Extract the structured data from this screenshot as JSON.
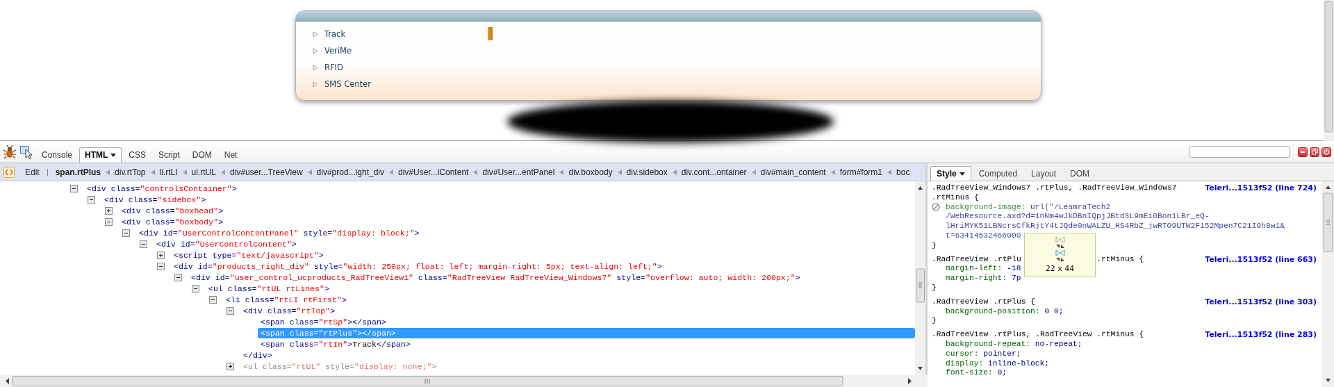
{
  "web_page": {
    "menu_panel": {
      "inspected_highlight": true,
      "items": [
        {
          "label": "Track",
          "expanded": false
        },
        {
          "label": "VeriMe",
          "expanded": false
        },
        {
          "label": "RFID",
          "expanded": false
        },
        {
          "label": "SMS Center",
          "expanded": false
        }
      ]
    }
  },
  "devtools": {
    "tabs": [
      {
        "label": "Console",
        "selected": false,
        "dropdown": false
      },
      {
        "label": "HTML",
        "selected": true,
        "dropdown": true
      },
      {
        "label": "CSS",
        "selected": false,
        "dropdown": false
      },
      {
        "label": "Script",
        "selected": false,
        "dropdown": false
      },
      {
        "label": "DOM",
        "selected": false,
        "dropdown": false
      },
      {
        "label": "Net",
        "selected": false,
        "dropdown": false
      }
    ],
    "breadcrumbs": {
      "edit_label": "Edit",
      "items": [
        {
          "label": "span.rtPlus",
          "selected": true
        },
        {
          "label": "div.rtTop",
          "selected": false
        },
        {
          "label": "li.rtLI",
          "selected": false
        },
        {
          "label": "ul.rtUL",
          "selected": false
        },
        {
          "label": "div#user...TreeView",
          "selected": false
        },
        {
          "label": "div#prod...ight_div",
          "selected": false
        },
        {
          "label": "div#User...lContent",
          "selected": false
        },
        {
          "label": "div#User...entPanel",
          "selected": false
        },
        {
          "label": "div.boxbody",
          "selected": false
        },
        {
          "label": "div.sidebox",
          "selected": false
        },
        {
          "label": "div.cont...ontainer",
          "selected": false
        },
        {
          "label": "div#main_content",
          "selected": false
        },
        {
          "label": "form#form1",
          "selected": false
        },
        {
          "label": "boc",
          "selected": false
        }
      ]
    },
    "html_tree": [
      {
        "selected": false,
        "hidden": false,
        "expanded": true,
        "parts": [
          {
            "kind": "tag",
            "text": "<div"
          },
          {
            "kind": "attr",
            "text": " class="
          },
          {
            "kind": "value",
            "text": "\"controlsContainer\""
          },
          {
            "kind": "tag",
            "text": ">"
          }
        ],
        "children": [
          {
            "selected": false,
            "hidden": false,
            "expanded": true,
            "parts": [
              {
                "kind": "tag",
                "text": "<div"
              },
              {
                "kind": "attr",
                "text": " class="
              },
              {
                "kind": "value",
                "text": "\"sidebox\""
              },
              {
                "kind": "tag",
                "text": ">"
              }
            ],
            "children": [
              {
                "selected": false,
                "hidden": false,
                "expanded": false,
                "parts": [
                  {
                    "kind": "tag",
                    "text": "<div"
                  },
                  {
                    "kind": "attr",
                    "text": " class="
                  },
                  {
                    "kind": "value",
                    "text": "\"boxhead\""
                  },
                  {
                    "kind": "tag",
                    "text": ">"
                  }
                ]
              },
              {
                "selected": false,
                "hidden": false,
                "expanded": true,
                "parts": [
                  {
                    "kind": "tag",
                    "text": "<div"
                  },
                  {
                    "kind": "attr",
                    "text": " class="
                  },
                  {
                    "kind": "value",
                    "text": "\"boxbody\""
                  },
                  {
                    "kind": "tag",
                    "text": ">"
                  }
                ],
                "children": [
                  {
                    "selected": false,
                    "hidden": false,
                    "expanded": true,
                    "parts": [
                      {
                        "kind": "tag",
                        "text": "<div"
                      },
                      {
                        "kind": "attr",
                        "text": " id="
                      },
                      {
                        "kind": "value",
                        "text": "\"UserControlContentPanel\""
                      },
                      {
                        "kind": "attr",
                        "text": " style="
                      },
                      {
                        "kind": "value",
                        "text": "\"display: block;\""
                      },
                      {
                        "kind": "tag",
                        "text": ">"
                      }
                    ],
                    "children": [
                      {
                        "selected": false,
                        "hidden": false,
                        "expanded": true,
                        "parts": [
                          {
                            "kind": "tag",
                            "text": "<div"
                          },
                          {
                            "kind": "attr",
                            "text": " id="
                          },
                          {
                            "kind": "value",
                            "text": "\"UserControlContent\""
                          },
                          {
                            "kind": "tag",
                            "text": ">"
                          }
                        ],
                        "children": [
                          {
                            "selected": false,
                            "hidden": false,
                            "expanded": false,
                            "parts": [
                              {
                                "kind": "tag",
                                "text": "<script"
                              },
                              {
                                "kind": "attr",
                                "text": " type="
                              },
                              {
                                "kind": "value",
                                "text": "\"text/javascript\""
                              },
                              {
                                "kind": "tag",
                                "text": ">"
                              }
                            ]
                          },
                          {
                            "selected": false,
                            "hidden": false,
                            "expanded": true,
                            "parts": [
                              {
                                "kind": "tag",
                                "text": "<div"
                              },
                              {
                                "kind": "attr",
                                "text": " id="
                              },
                              {
                                "kind": "value",
                                "text": "\"products_right_div\""
                              },
                              {
                                "kind": "attr",
                                "text": " style="
                              },
                              {
                                "kind": "value",
                                "text": "\"width: 250px; float: left; margin-right: 5px; text-align: left;\""
                              },
                              {
                                "kind": "tag",
                                "text": ">"
                              }
                            ],
                            "children": [
                              {
                                "selected": false,
                                "hidden": false,
                                "expanded": true,
                                "parts": [
                                  {
                                    "kind": "tag",
                                    "text": "<div"
                                  },
                                  {
                                    "kind": "attr",
                                    "text": " id="
                                  },
                                  {
                                    "kind": "value",
                                    "text": "\"user_control_ucproducts_RadTreeView1\""
                                  },
                                  {
                                    "kind": "attr",
                                    "text": " class="
                                  },
                                  {
                                    "kind": "value",
                                    "text": "\"RadTreeView RadTreeView_Windows7\""
                                  },
                                  {
                                    "kind": "attr",
                                    "text": " style="
                                  },
                                  {
                                    "kind": "value",
                                    "text": "\"overflow: auto; width: 200px;\""
                                  },
                                  {
                                    "kind": "tag",
                                    "text": ">"
                                  }
                                ],
                                "children": [
                                  {
                                    "selected": false,
                                    "hidden": false,
                                    "expanded": true,
                                    "parts": [
                                      {
                                        "kind": "tag",
                                        "text": "<ul"
                                      },
                                      {
                                        "kind": "attr",
                                        "text": " class="
                                      },
                                      {
                                        "kind": "value",
                                        "text": "\"rtUL rtLines\""
                                      },
                                      {
                                        "kind": "tag",
                                        "text": ">"
                                      }
                                    ],
                                    "children": [
                                      {
                                        "selected": false,
                                        "hidden": false,
                                        "expanded": true,
                                        "parts": [
                                          {
                                            "kind": "tag",
                                            "text": "<li"
                                          },
                                          {
                                            "kind": "attr",
                                            "text": " class="
                                          },
                                          {
                                            "kind": "value",
                                            "text": "\"rtLI rtFirst\""
                                          },
                                          {
                                            "kind": "tag",
                                            "text": ">"
                                          }
                                        ],
                                        "children": [
                                          {
                                            "selected": false,
                                            "hidden": false,
                                            "expanded": true,
                                            "closing": "</div>",
                                            "parts": [
                                              {
                                                "kind": "tag",
                                                "text": "<div"
                                              },
                                              {
                                                "kind": "attr",
                                                "text": " class="
                                              },
                                              {
                                                "kind": "value",
                                                "text": "\"rtTop\""
                                              },
                                              {
                                                "kind": "tag",
                                                "text": ">"
                                              }
                                            ],
                                            "children": [
                                              {
                                                "selected": false,
                                                "hidden": false,
                                                "parts": [
                                                  {
                                                    "kind": "tag",
                                                    "text": "<span"
                                                  },
                                                  {
                                                    "kind": "attr",
                                                    "text": " class="
                                                  },
                                                  {
                                                    "kind": "value",
                                                    "text": "\"rtSp\""
                                                  },
                                                  {
                                                    "kind": "tag",
                                                    "text": "></span>"
                                                  }
                                                ]
                                              },
                                              {
                                                "selected": true,
                                                "hidden": false,
                                                "parts": [
                                                  {
                                                    "kind": "tag",
                                                    "text": "<span"
                                                  },
                                                  {
                                                    "kind": "attr",
                                                    "text": " class="
                                                  },
                                                  {
                                                    "kind": "value",
                                                    "text": "\"rtPlus\""
                                                  },
                                                  {
                                                    "kind": "tag",
                                                    "text": "></span>"
                                                  }
                                                ]
                                              },
                                              {
                                                "selected": false,
                                                "hidden": false,
                                                "parts": [
                                                  {
                                                    "kind": "tag",
                                                    "text": "<span"
                                                  },
                                                  {
                                                    "kind": "attr",
                                                    "text": " class="
                                                  },
                                                  {
                                                    "kind": "value",
                                                    "text": "\"rtIn\""
                                                  },
                                                  {
                                                    "kind": "tag",
                                                    "text": ">"
                                                  },
                                                  {
                                                    "kind": "text",
                                                    "text": "Track"
                                                  },
                                                  {
                                                    "kind": "tag",
                                                    "text": "</span>"
                                                  }
                                                ]
                                              }
                                            ]
                                          },
                                          {
                                            "selected": false,
                                            "hidden": true,
                                            "expanded": false,
                                            "parts": [
                                              {
                                                "kind": "tag",
                                                "text": "<ul"
                                              },
                                              {
                                                "kind": "attr",
                                                "text": " class="
                                              },
                                              {
                                                "kind": "value",
                                                "text": "\"rtUL\""
                                              },
                                              {
                                                "kind": "attr",
                                                "text": " style="
                                              },
                                              {
                                                "kind": "value",
                                                "text": "\"display: none;\""
                                              },
                                              {
                                                "kind": "tag",
                                                "text": ">"
                                              }
                                            ]
                                          }
                                        ]
                                      }
                                    ]
                                  }
                                ]
                              }
                            ]
                          }
                        ]
                      }
                    ]
                  }
                ]
              }
            ]
          }
        ]
      }
    ],
    "side_tabs": [
      {
        "label": "Style",
        "selected": true,
        "dropdown": true
      },
      {
        "label": "Computed",
        "selected": false,
        "dropdown": false
      },
      {
        "label": "Layout",
        "selected": false,
        "dropdown": false
      },
      {
        "label": "DOM",
        "selected": false,
        "dropdown": false
      }
    ],
    "css_rules": [
      {
        "source": "Teleri...1513f52 (line 724)",
        "selector_lines": [
          [
            ".RadTreeView_Windows7 .rtPlus, .RadTreeView_Windows7"
          ],
          [
            ".rtMinus {"
          ]
        ],
        "declarations": [
          {
            "property": "background-image:",
            "disabled": true,
            "value_lines": [
              "url(\"/LeamraTech2",
              "/WebResource.axd?d=1nNm4wJkDBnIQpjJBtd3L9mEi0Bon1LBr_eQ-",
              "lHriMYK51LBNcrsCfkRjtY4tJQde0nWALZU_HS4RbZ_jwRTO9UTW2F152Mpen7C21I9h8w1&",
              "t=63414532466000"
            ]
          }
        ],
        "close": "}"
      },
      {
        "source": "Teleri...1513f52 (line 663)",
        "selector_lines": [
          [
            ".RadTreeView .rtPlu",
            ".rtMinus {"
          ]
        ],
        "declarations": [
          {
            "property": "margin-left:",
            "disabled": false,
            "value_lines": [
              "-18"
            ]
          },
          {
            "property": "margin-right:",
            "disabled": false,
            "value_lines": [
              "7p"
            ]
          }
        ],
        "close": "}"
      },
      {
        "source": "Teleri...1513f52 (line 303)",
        "selector_lines": [
          [
            ".RadTreeView .rtPlus {"
          ]
        ],
        "declarations": [
          {
            "property": "background-position:",
            "disabled": false,
            "value_lines": [
              "0 0;"
            ]
          }
        ],
        "close": "}"
      },
      {
        "source": "Teleri...1513f52 (line 283)",
        "selector_lines": [
          [
            ".RadTreeView .rtPlus, .RadTreeView .rtMinus {"
          ]
        ],
        "declarations": [
          {
            "property": "background-repeat:",
            "disabled": false,
            "value_lines": [
              "no-repeat;"
            ]
          },
          {
            "property": "cursor:",
            "disabled": false,
            "value_lines": [
              "pointer;"
            ]
          },
          {
            "property": "display:",
            "disabled": false,
            "value_lines": [
              "inline-block;"
            ]
          },
          {
            "property": "font-size:",
            "disabled": false,
            "value_lines": [
              "0;"
            ]
          }
        ]
      }
    ],
    "tooltip": {
      "size": "22 x 44"
    }
  }
}
